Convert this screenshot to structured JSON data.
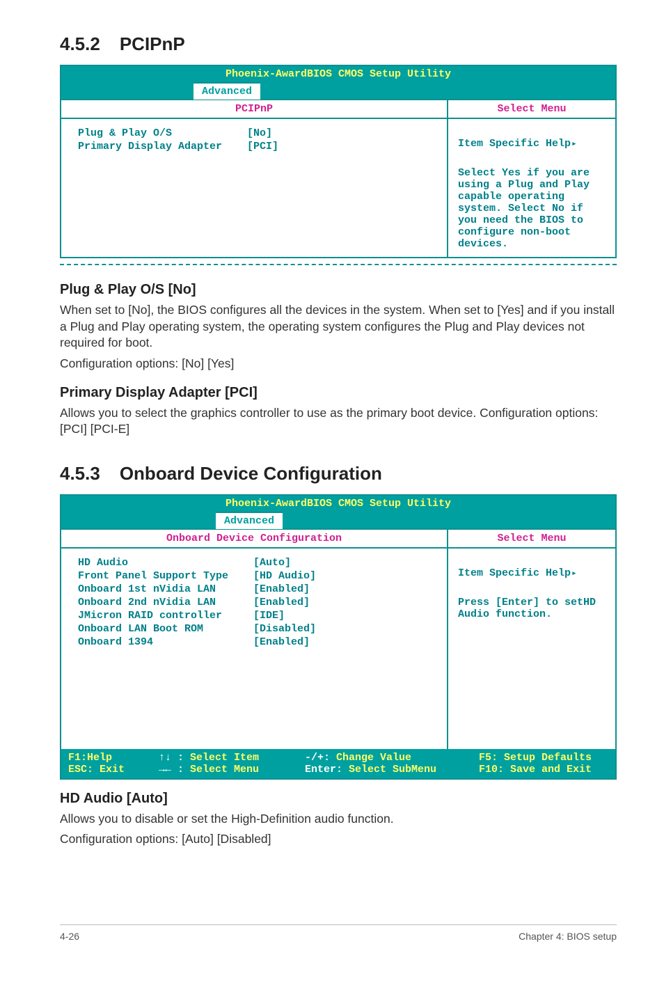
{
  "sec452": {
    "num": "4.5.2",
    "title": "PCIPnP"
  },
  "bios1": {
    "title": "Phoenix-AwardBIOS CMOS Setup Utility",
    "tab": "Advanced",
    "header_left": "PCIPnP",
    "header_right": "Select Menu",
    "rows": [
      {
        "label": "Plug & Play O/S",
        "value": "[No]"
      },
      {
        "label": "Primary Display Adapter",
        "value": "[PCI]"
      }
    ],
    "help_title": "Item Specific Help",
    "help_body": "Select Yes if you are using a Plug and Play capable operating system. Select No if you need the BIOS to configure non-boot devices."
  },
  "sub1": {
    "heading": "Plug & Play O/S [No]",
    "p1": "When set to [No], the BIOS configures all the devices in the system. When set to [Yes] and if you install a Plug and Play operating system, the operating system configures the Plug and Play devices not required for boot.",
    "p2": "Configuration options: [No] [Yes]"
  },
  "sub2": {
    "heading": "Primary Display Adapter [PCI]",
    "p1": "Allows you to select the graphics controller to use as the primary boot device. Configuration options: [PCI] [PCI-E]"
  },
  "sec453": {
    "num": "4.5.3",
    "title": "Onboard Device Configuration"
  },
  "bios2": {
    "title": "Phoenix-AwardBIOS CMOS Setup Utility",
    "tab": "Advanced",
    "header_left": "Onboard Device Configuration",
    "header_right": "Select Menu",
    "rows": [
      {
        "label": "HD Audio",
        "value": "[Auto]"
      },
      {
        "label": "Front Panel Support Type",
        "value": "[HD Audio]"
      },
      {
        "label": "Onboard 1st nVidia LAN",
        "value": "[Enabled]"
      },
      {
        "label": "Onboard 2nd nVidia LAN",
        "value": "[Enabled]"
      },
      {
        "label": "JMicron RAID controller",
        "value": "[IDE]"
      },
      {
        "label": "Onboard LAN Boot ROM",
        "value": "[Disabled]"
      },
      {
        "label": "Onboard 1394",
        "value": "[Enabled]"
      }
    ],
    "help_title": "Item Specific Help",
    "help_body": "Press [Enter] to setHD Audio function.",
    "footer": {
      "c1a": "F1:Help",
      "c1b": "ESC: Exit",
      "c2a_k": "↑↓ :",
      "c2a_v": "Select Item",
      "c2b_k": "→← :",
      "c2b_v": "Select Menu",
      "c3a_k": "-/+:",
      "c3a_v": "Change Value",
      "c3b_k": "Enter:",
      "c3b_v": "Select SubMenu",
      "c4a": "F5: Setup Defaults",
      "c4b": "F10: Save and Exit"
    }
  },
  "sub3": {
    "heading": "HD Audio [Auto]",
    "p1": "Allows you to disable or set the High-Definition audio function.",
    "p2": "Configuration options: [Auto] [Disabled]"
  },
  "footer": {
    "left": "4-26",
    "right": "Chapter 4: BIOS setup"
  }
}
